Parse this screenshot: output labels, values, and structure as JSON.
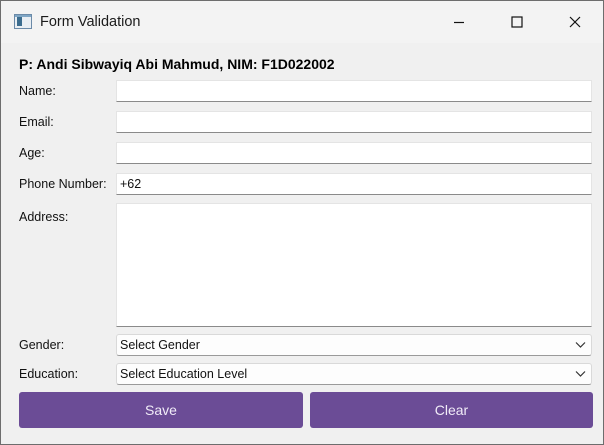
{
  "window": {
    "title": "Form Validation"
  },
  "header": {
    "text": "P: Andi Sibwayiq Abi Mahmud, NIM: F1D022002"
  },
  "form": {
    "name": {
      "label": "Name:",
      "value": ""
    },
    "email": {
      "label": "Email:",
      "value": ""
    },
    "age": {
      "label": "Age:",
      "value": ""
    },
    "phone": {
      "label": "Phone Number:",
      "value": "+62"
    },
    "address": {
      "label": "Address:",
      "value": ""
    },
    "gender": {
      "label": "Gender:",
      "selected": "Select Gender"
    },
    "education": {
      "label": "Education:",
      "selected": "Select Education Level"
    }
  },
  "actions": {
    "save_label": "Save",
    "clear_label": "Clear"
  },
  "icons": {
    "app": "form-app-icon",
    "minimize": "minimize-icon",
    "maximize": "maximize-icon",
    "close": "close-icon",
    "dropdown": "chevron-down-icon"
  },
  "colors": {
    "button": "#6b4c96",
    "window_bg": "#f0f0f0"
  }
}
